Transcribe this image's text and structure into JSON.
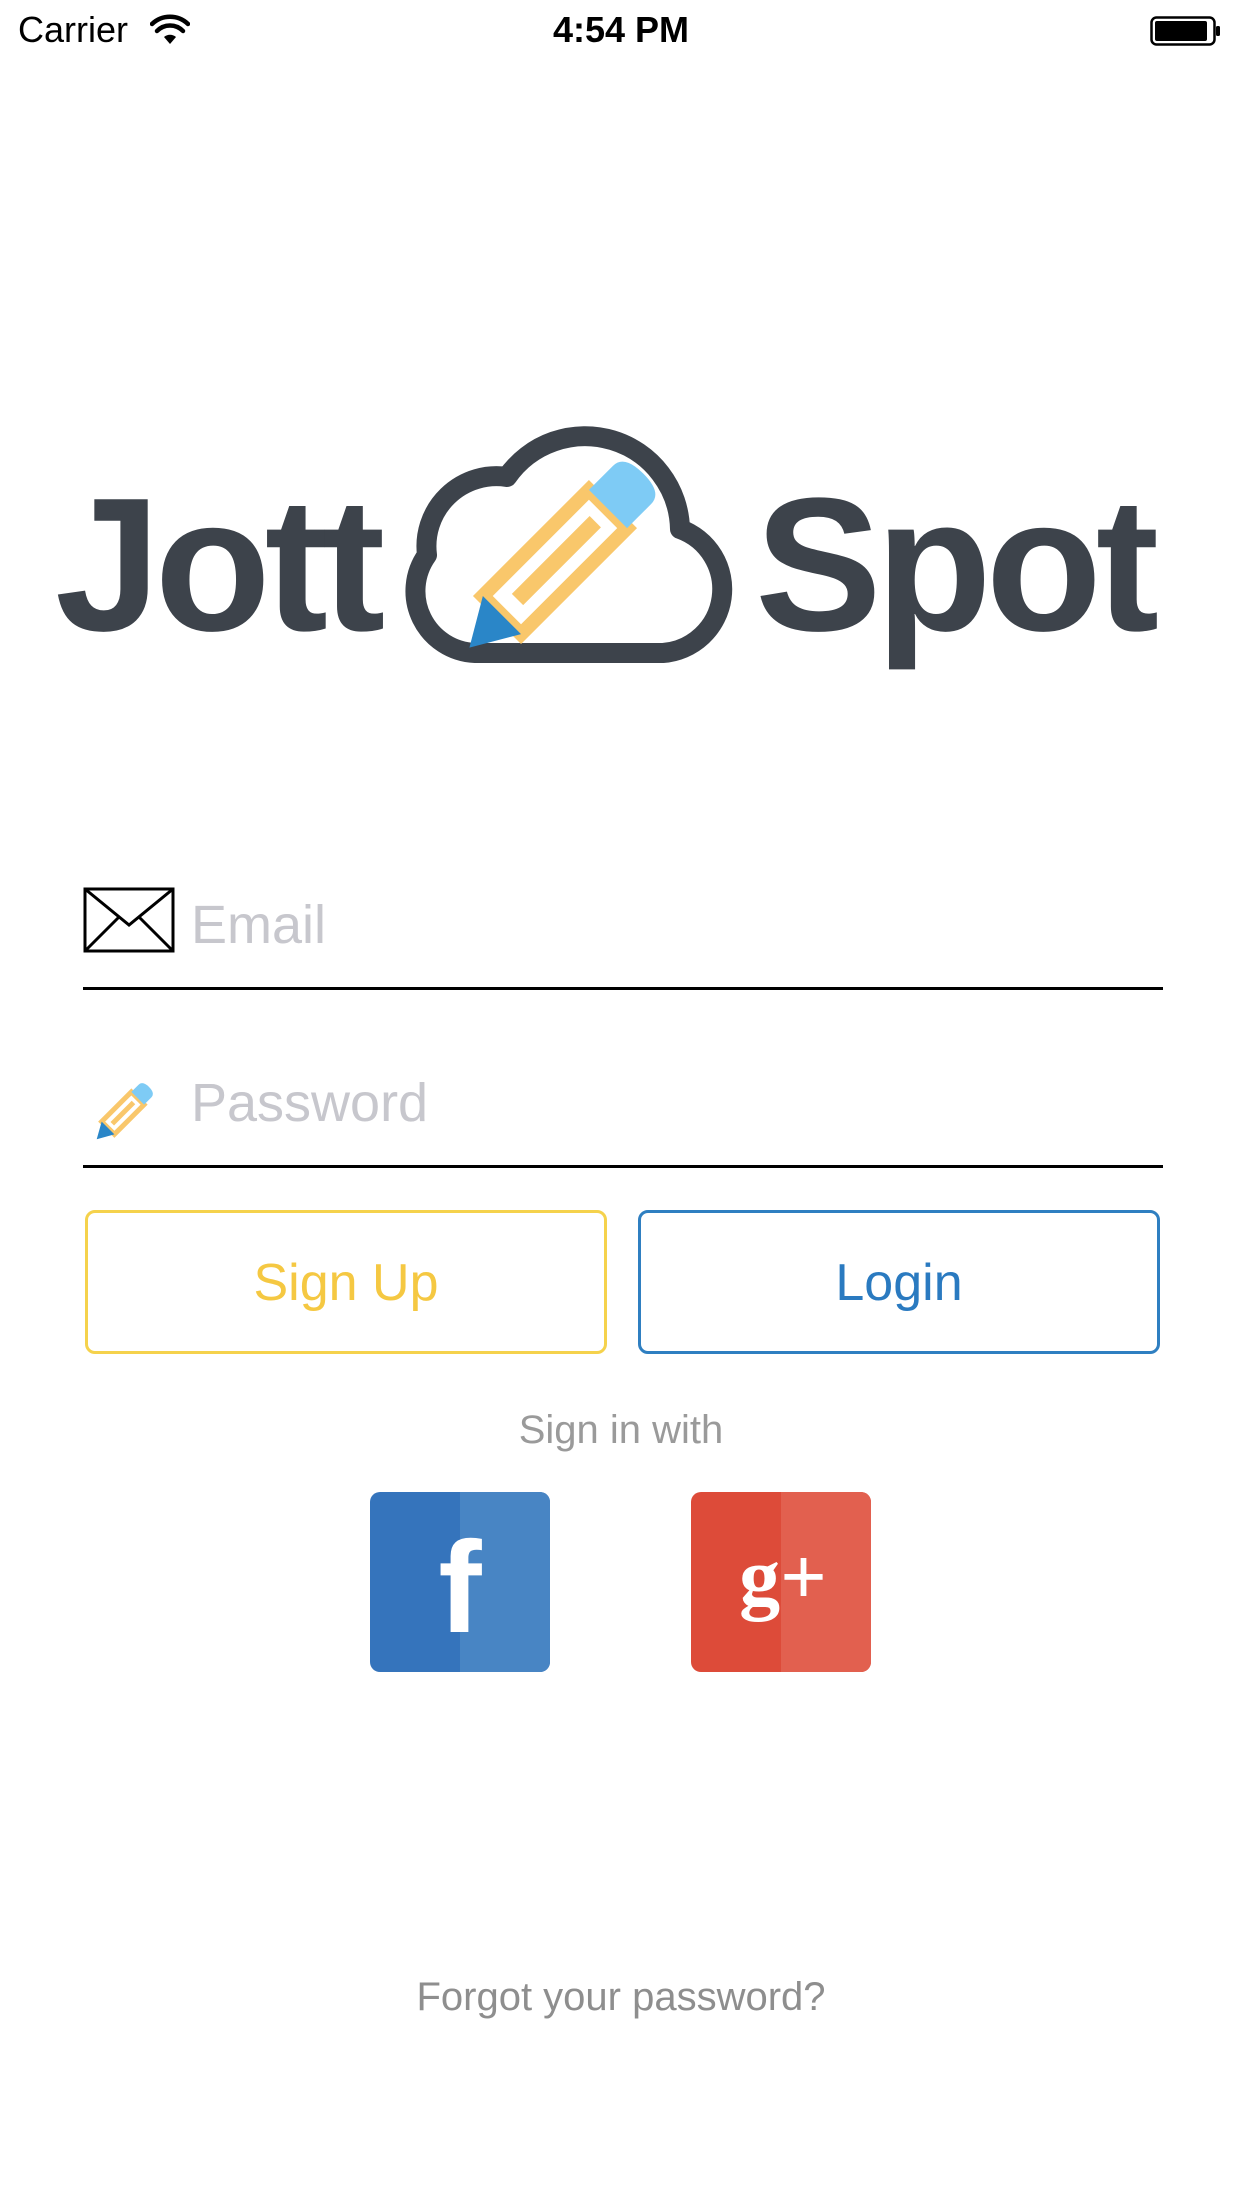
{
  "status_bar": {
    "carrier": "Carrier",
    "time": "4:54 PM"
  },
  "logo": {
    "text_left": "Jott",
    "text_right": "Spot"
  },
  "form": {
    "email": {
      "placeholder": "Email",
      "value": "",
      "icon": "envelope-icon"
    },
    "password": {
      "placeholder": "Password",
      "value": "",
      "icon": "pencil-icon"
    }
  },
  "buttons": {
    "signup_label": "Sign Up",
    "login_label": "Login"
  },
  "social": {
    "caption": "Sign in with",
    "facebook_glyph": "f",
    "google_glyph": "g+"
  },
  "forgot_label": "Forgot your password?",
  "colors": {
    "brand_dark": "#3d434b",
    "accent_yellow": "#f5c842",
    "accent_blue": "#2a7ac0",
    "facebook": "#3574bc",
    "google": "#dd4b39"
  }
}
